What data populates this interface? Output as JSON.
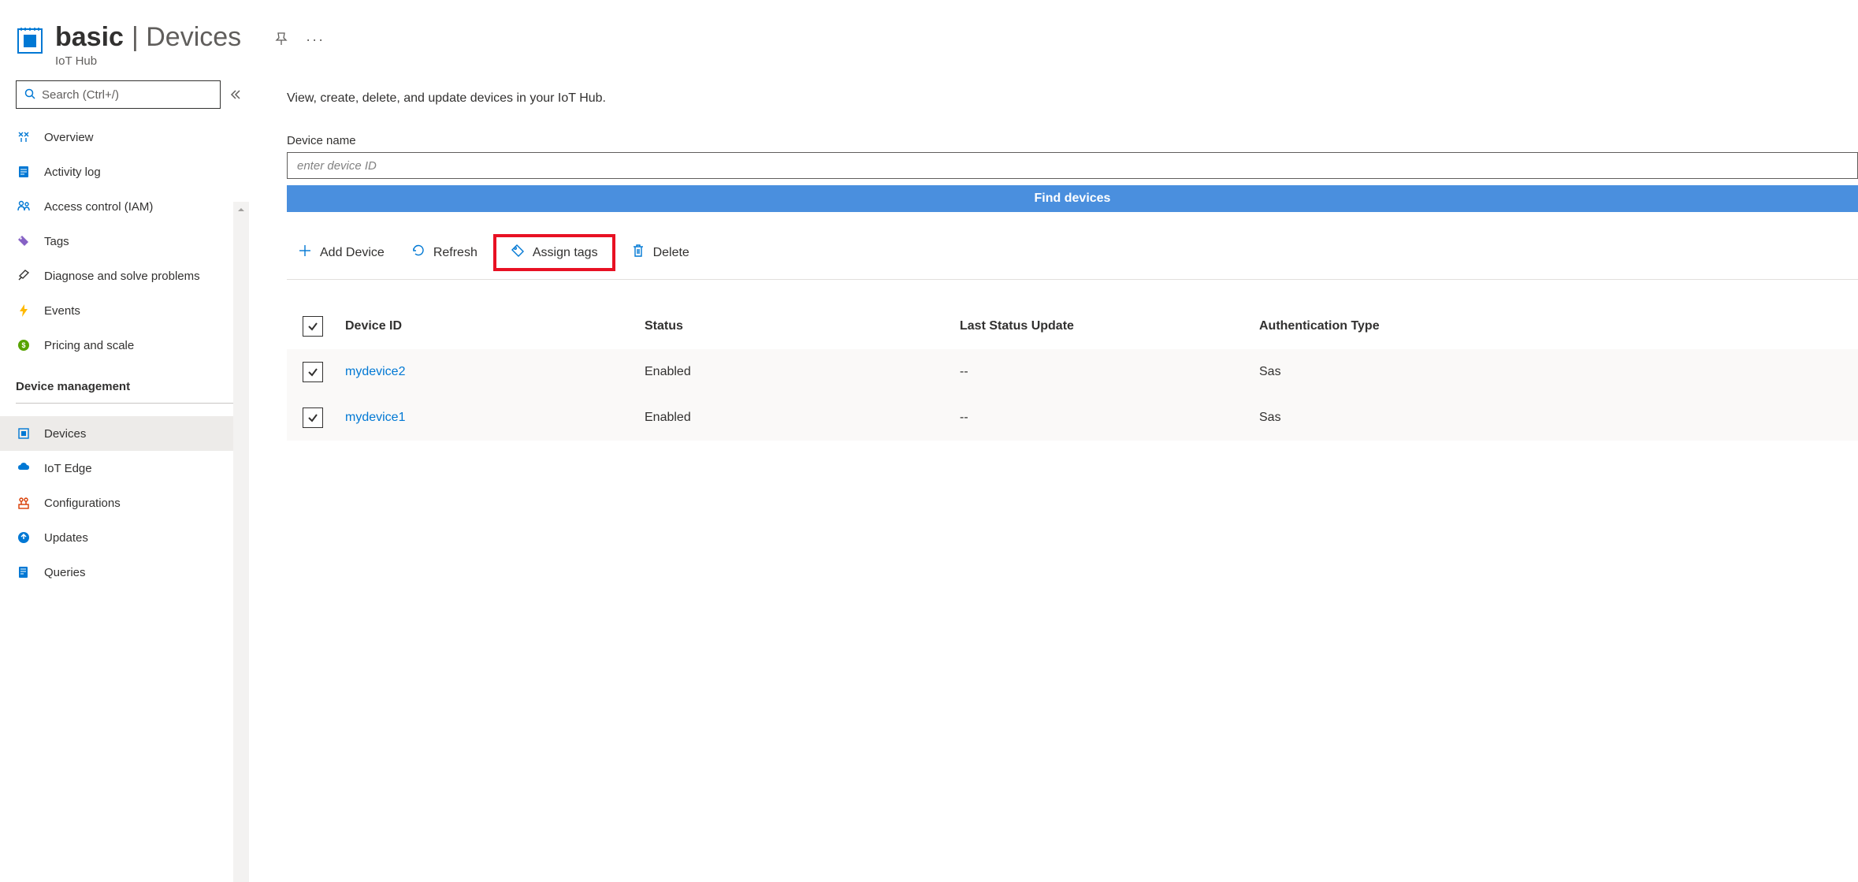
{
  "header": {
    "resource_name": "basic",
    "section_suffix": "| Devices",
    "subtitle": "IoT Hub"
  },
  "sidebar": {
    "search_placeholder": "Search (Ctrl+/)",
    "items_general": [
      {
        "label": "Overview",
        "icon": "overview-icon"
      },
      {
        "label": "Activity log",
        "icon": "activity-log-icon"
      },
      {
        "label": "Access control (IAM)",
        "icon": "access-control-icon"
      },
      {
        "label": "Tags",
        "icon": "tags-icon"
      },
      {
        "label": "Diagnose and solve problems",
        "icon": "diagnose-icon"
      },
      {
        "label": "Events",
        "icon": "events-icon"
      },
      {
        "label": "Pricing and scale",
        "icon": "pricing-icon"
      }
    ],
    "section_device_mgmt": "Device management",
    "items_device": [
      {
        "label": "Devices",
        "icon": "devices-icon",
        "active": true
      },
      {
        "label": "IoT Edge",
        "icon": "iot-edge-icon"
      },
      {
        "label": "Configurations",
        "icon": "configurations-icon"
      },
      {
        "label": "Updates",
        "icon": "updates-icon"
      },
      {
        "label": "Queries",
        "icon": "queries-icon"
      }
    ]
  },
  "main": {
    "description": "View, create, delete, and update devices in your IoT Hub.",
    "device_name_label": "Device name",
    "device_input_placeholder": "enter device ID",
    "find_button": "Find devices",
    "toolbar": {
      "add": "Add Device",
      "refresh": "Refresh",
      "assign_tags": "Assign tags",
      "delete": "Delete"
    },
    "table": {
      "columns": [
        "Device ID",
        "Status",
        "Last Status Update",
        "Authentication Type"
      ],
      "rows": [
        {
          "id": "mydevice2",
          "status": "Enabled",
          "last": "--",
          "auth": "Sas",
          "checked": true
        },
        {
          "id": "mydevice1",
          "status": "Enabled",
          "last": "--",
          "auth": "Sas",
          "checked": true
        }
      ]
    }
  }
}
